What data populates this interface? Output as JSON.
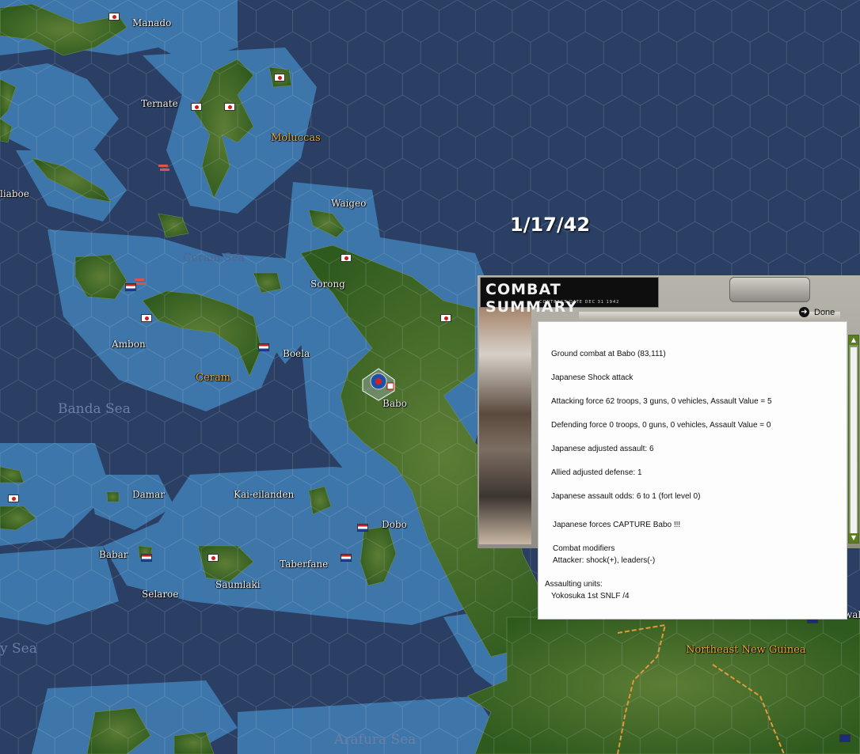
{
  "map": {
    "date": "1/17/42",
    "places": [
      "Manado",
      "Ternate",
      "Moluccas",
      "liaboe",
      "Waigeo",
      "Ceram Sea",
      "Sorong",
      "Ambon",
      "Boela",
      "Ceram",
      "Banda Sea",
      "Babo",
      "Damar",
      "Kai-eilanden",
      "Dobo",
      "Babar",
      "Taberfane",
      "Saumlaki",
      "Selaroe",
      "Northeast New Guinea",
      "Arafura Sea",
      "y Sea",
      "wal"
    ]
  },
  "combat_summary": {
    "title": "COMBAT SUMMARY",
    "subtitle": "CONTRACT DATE DEC 31 1942",
    "done_label": "Done",
    "lines": [
      "Ground combat at Babo (83,111)",
      "Japanese Shock attack",
      "Attacking force 62 troops, 3 guns, 0 vehicles, Assault Value = 5",
      "Defending force 0 troops, 0 guns, 0 vehicles, Assault Value = 0",
      "Japanese adjusted assault: 6",
      "Allied adjusted defense: 1",
      "Japanese assault odds: 6 to 1 (fort level 0)",
      "Japanese forces CAPTURE Babo !!!",
      "Combat modifiers",
      "Attacker: shock(+), leaders(-)",
      "Assaulting units:",
      "Yokosuka 1st SNLF /4"
    ]
  },
  "colors": {
    "deep_sea": "#2a3f63",
    "shallow_sea": "#3f7ab0",
    "land": "#3f6a24",
    "label": "#f2f2f2",
    "region_label": "#e8a83a"
  },
  "icons": [
    "japanese-flag-icon",
    "dutch-flag-icon",
    "australian-flag-icon",
    "naval-unit-icon",
    "unit-counter-icon",
    "done-arrow-icon"
  ]
}
